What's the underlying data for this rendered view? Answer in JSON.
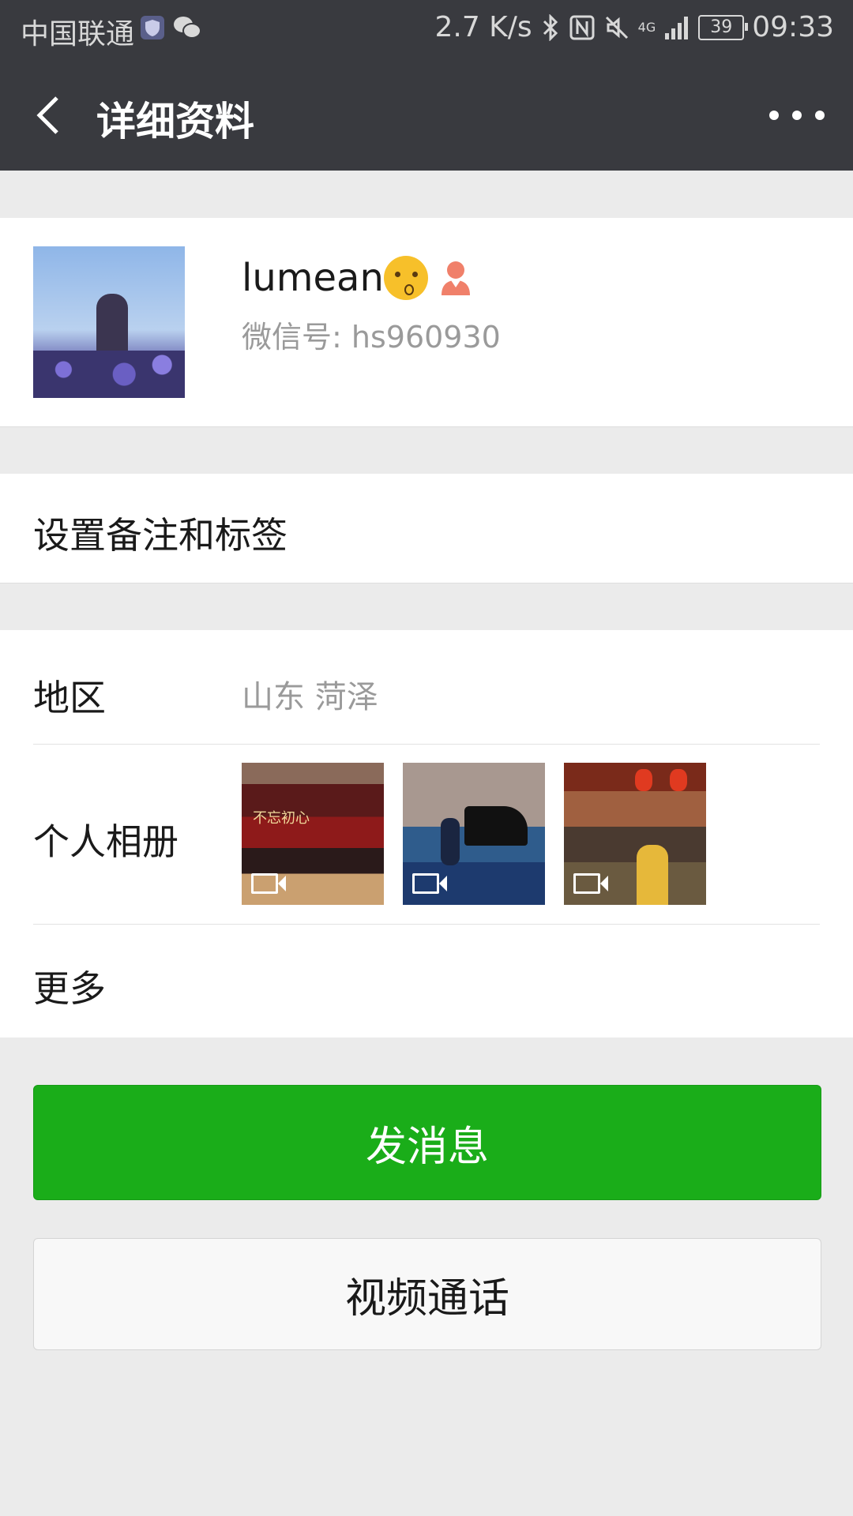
{
  "status_bar": {
    "carrier": "中国联通",
    "speed": "2.7 K/s",
    "network": "4G",
    "battery": "39",
    "time": "09:33"
  },
  "header": {
    "title": "详细资料"
  },
  "profile": {
    "nickname": "lumean",
    "wechat_id": "微信号: hs960930",
    "gender_icon": "female-icon"
  },
  "remark": {
    "label": "设置备注和标签"
  },
  "info": {
    "region_label": "地区",
    "region_value": "山东  菏泽",
    "album_label": "个人相册",
    "album_thumb1_text": "不忘初心",
    "more_label": "更多"
  },
  "actions": {
    "message_button": "发消息",
    "video_call_button": "视频通话"
  },
  "colors": {
    "header_bg": "#393a3f",
    "primary_green": "#1aad19",
    "page_bg": "#ebebeb"
  }
}
